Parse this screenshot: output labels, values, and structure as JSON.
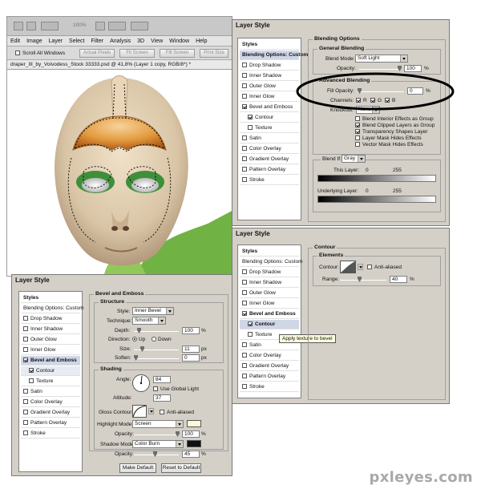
{
  "app": {
    "zoom": "100%",
    "menu": [
      "Edit",
      "Image",
      "Layer",
      "Select",
      "Filter",
      "Analysis",
      "3D",
      "View",
      "Window",
      "Help"
    ],
    "options": {
      "scroll_all": "Scroll All Windows",
      "actual_pixels": "Actual Pixels",
      "fit_screen": "Fit Screen",
      "fill_screen": "Fill Screen",
      "print_size": "Print Size"
    },
    "doc_tab": "draper_III_by_Voivodess_Stock  33333.psd @ 41,8% (Layer 1 copy, RGB/8*) *"
  },
  "dialog_title": "Layer Style",
  "style_list": {
    "styles": "Styles",
    "blending": "Blending Options: Custom",
    "items": [
      "Drop Shadow",
      "Inner Shadow",
      "Outer Glow",
      "Inner Glow",
      "Bevel and Emboss",
      "Contour",
      "Texture",
      "Satin",
      "Color Overlay",
      "Gradient Overlay",
      "Pattern Overlay",
      "Stroke"
    ]
  },
  "blending": {
    "section": "Blending Options",
    "general": "General Blending",
    "blend_mode_label": "Blend Mode:",
    "blend_mode": "Soft Light",
    "opacity_label": "Opacity:",
    "opacity": "100",
    "pct": "%",
    "advanced": "Advanced Blending",
    "fill_opacity_label": "Fill Opacity:",
    "fill_opacity": "0",
    "channels_label": "Channels:",
    "ch_r": "R",
    "ch_g": "G",
    "ch_b": "B",
    "knockout_label": "Knockout:",
    "knockout": "None",
    "checks": [
      "Blend Interior Effects as Group",
      "Blend Clipped Layers as Group",
      "Transparency Shapes Layer",
      "Layer Mask Hides Effects",
      "Vector Mask Hides Effects"
    ],
    "blend_if_label": "Blend If:",
    "blend_if": "Gray",
    "this_layer": "This Layer:",
    "underlying": "Underlying Layer:",
    "min": "0",
    "max": "255"
  },
  "contour_panel": {
    "section": "Contour",
    "elements": "Elements",
    "contour_label": "Contour:",
    "anti_aliased": "Anti-aliased",
    "range_label": "Range:",
    "range": "40",
    "pct": "%",
    "tooltip": "Apply texture to bevel"
  },
  "bevel": {
    "section": "Bevel and Emboss",
    "structure": "Structure",
    "style_label": "Style:",
    "style": "Inner Bevel",
    "technique_label": "Technique:",
    "technique": "Smooth",
    "depth_label": "Depth:",
    "depth": "100",
    "direction_label": "Direction:",
    "up": "Up",
    "down": "Down",
    "size_label": "Size:",
    "size": "11",
    "soften_label": "Soften:",
    "soften": "0",
    "px": "px",
    "pct": "%",
    "shading": "Shading",
    "angle_label": "Angle:",
    "angle": "84",
    "global_light": "Use Global Light",
    "altitude_label": "Altitude:",
    "altitude": "37",
    "gloss_label": "Gloss Contour:",
    "anti_aliased": "Anti-aliased",
    "highlight_label": "Highlight Mode:",
    "highlight_mode": "Screen",
    "hl_opacity": "100",
    "shadow_label": "Shadow Mode:",
    "shadow_mode": "Color Burn",
    "sh_opacity": "45",
    "opacity_label": "Opacity:",
    "make_default": "Make Default",
    "reset_default": "Reset to Default"
  },
  "colors": {
    "highlight_swatch": "#fff8d8",
    "shadow_swatch": "#111111",
    "selection": "#cfd6e6"
  },
  "watermark": "pxleyes.com"
}
